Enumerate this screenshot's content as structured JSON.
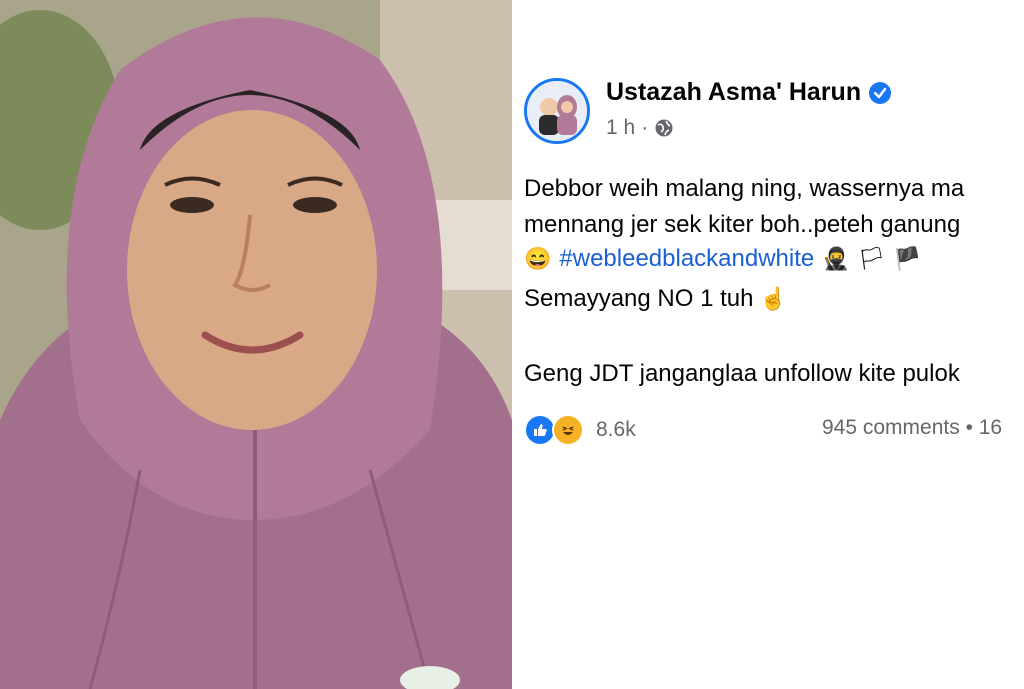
{
  "post": {
    "author": "Ustazah Asma' Harun",
    "time": "1 h",
    "separator": "·",
    "lines": {
      "l1": "Debbor weih malang ning, wassernya ma",
      "l2": "mennang jer sek kiter boh..peteh ganung",
      "l3_hashtag": "#webleedblackandwhite",
      "l4": "Semayyang NO 1 tuh",
      "l5": "Geng JDT janganglaa unfollow kite pulok"
    },
    "emojis": {
      "grin": "😄",
      "ninja": "🥷",
      "flag_white": "🏳",
      "flag_black": "🏴",
      "point_up": "☝"
    },
    "reactions_count": "8.6k",
    "comments_shares": "945 comments • 16"
  },
  "colors": {
    "facebook_blue": "#1877f2",
    "hashtag": "#1a5fd6",
    "meta_gray": "#65676b",
    "hijab_mauve": "#b07a98"
  },
  "icons": [
    "verified-badge-icon",
    "globe-icon",
    "like-reaction-icon",
    "haha-reaction-icon"
  ]
}
